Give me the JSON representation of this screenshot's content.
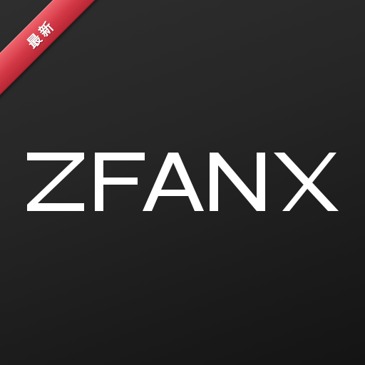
{
  "icon": {
    "badge_label": "最新",
    "brand_wordmark": "ZFANX"
  },
  "colors": {
    "background": "#262626",
    "ribbon": "#d23845",
    "wordmark": "#ffffff"
  }
}
